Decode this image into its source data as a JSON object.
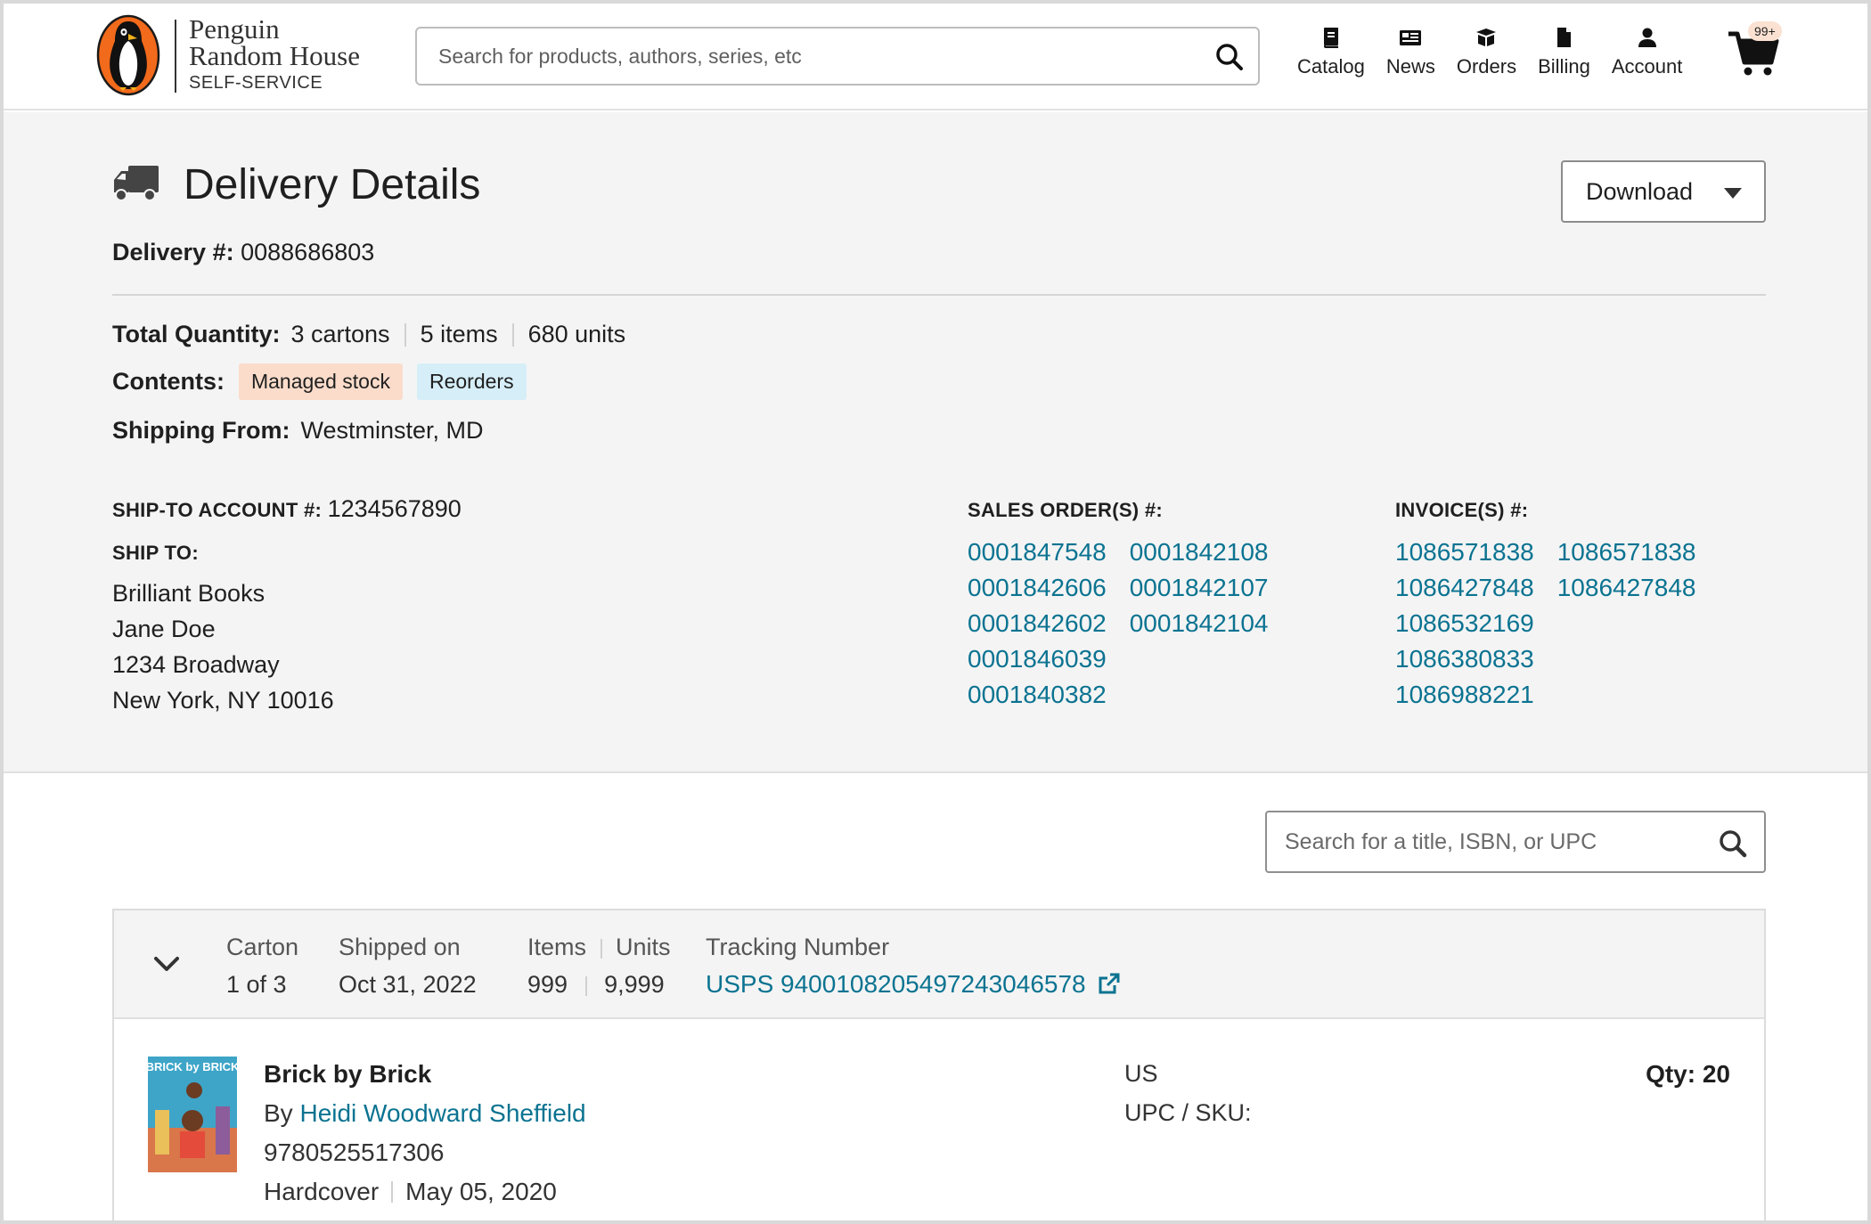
{
  "header": {
    "brand_line1": "Penguin",
    "brand_line2": "Random House",
    "brand_line3": "SELF-SERVICE",
    "search_placeholder": "Search for products, authors, series, etc",
    "nav": [
      {
        "label": "Catalog",
        "icon": "book-icon"
      },
      {
        "label": "News",
        "icon": "newspaper-icon"
      },
      {
        "label": "Orders",
        "icon": "box-icon"
      },
      {
        "label": "Billing",
        "icon": "document-icon"
      },
      {
        "label": "Account",
        "icon": "user-icon"
      }
    ],
    "cart_badge": "99+"
  },
  "details": {
    "title": "Delivery Details",
    "download_label": "Download",
    "delivery_label": "Delivery #:",
    "delivery_number": "0088686803",
    "total_quantity_label": "Total Quantity:",
    "cartons": "3 cartons",
    "items": "5 items",
    "units": "680 units",
    "contents_label": "Contents:",
    "tags": [
      "Managed stock",
      "Reorders"
    ],
    "shipping_from_label": "Shipping From:",
    "shipping_from": "Westminster, MD",
    "ship_to_account_label": "SHIP-TO ACCOUNT #:",
    "ship_to_account": "1234567890",
    "ship_to_label": "SHIP TO:",
    "ship_to_lines": [
      "Brilliant Books",
      "Jane Doe",
      "1234 Broadway",
      "New York, NY 10016"
    ],
    "sales_orders_label": "SALES ORDER(S) #:",
    "sales_orders": [
      "0001847548",
      "0001842108",
      "0001842606",
      "0001842107",
      "0001842602",
      "0001842104",
      "0001846039",
      "",
      "0001840382",
      ""
    ],
    "invoices_label": "INVOICE(S) #:",
    "invoices": [
      "1086571838",
      "1086571838",
      "1086427848",
      "1086427848",
      "1086532169",
      "",
      "1086380833",
      "",
      "1086988221",
      ""
    ]
  },
  "lower": {
    "title_search_placeholder": "Search for a title, ISBN, or UPC",
    "carton": {
      "carton_label": "Carton",
      "carton_value": "1 of 3",
      "shipped_label": "Shipped on",
      "shipped_value": "Oct 31, 2022",
      "items_label": "Items",
      "items_value": "999",
      "units_label": "Units",
      "units_value": "9,999",
      "tracking_label": "Tracking Number",
      "tracking_value": "USPS 9400108205497243046578"
    },
    "item": {
      "title": "Brick by Brick",
      "by": "By",
      "author": "Heidi Woodward Sheffield",
      "isbn": "9780525517306",
      "format": "Hardcover",
      "date": "May 05, 2020",
      "country": "US",
      "upc_label": "UPC / SKU:",
      "qty": "Qty: 20",
      "cover_text": "BRICK by BRICK"
    }
  },
  "colors": {
    "link": "#0b7391",
    "panel_bg": "#f4f4f4",
    "tag_managed": "#fbdccb",
    "tag_reorders": "#d6eef8",
    "logo_orange": "#f26a1b"
  }
}
